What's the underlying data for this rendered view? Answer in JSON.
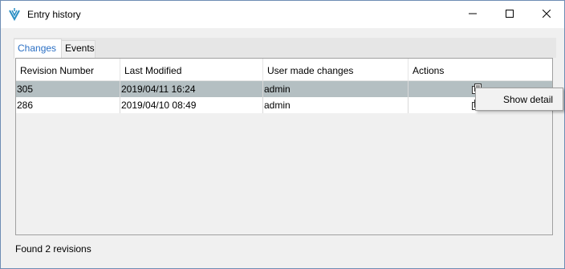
{
  "window": {
    "title": "Entry history",
    "icon": "app-logo-icon",
    "controls": {
      "minimize": "minimize-icon",
      "maximize": "maximize-icon",
      "close": "close-icon"
    }
  },
  "tabs": [
    {
      "label": "Changes",
      "active": true
    },
    {
      "label": "Events",
      "active": false
    }
  ],
  "table": {
    "columns": [
      "Revision Number",
      "Last Modified",
      "User made changes",
      "Actions"
    ],
    "rows": [
      {
        "revision": "305",
        "modified": "2019/04/11 16:24",
        "user": "admin",
        "action_icon": "copy-icon",
        "selected": true
      },
      {
        "revision": "286",
        "modified": "2019/04/10 08:49",
        "user": "admin",
        "action_icon": "copy-icon",
        "selected": false
      }
    ]
  },
  "context_menu": {
    "items": [
      "Show detail"
    ]
  },
  "status": {
    "text": "Found 2 revisions"
  },
  "colors": {
    "accent_tab": "#2a6fc4",
    "selected_row": "#b4bfc2",
    "window_border": "#6e8db4"
  }
}
